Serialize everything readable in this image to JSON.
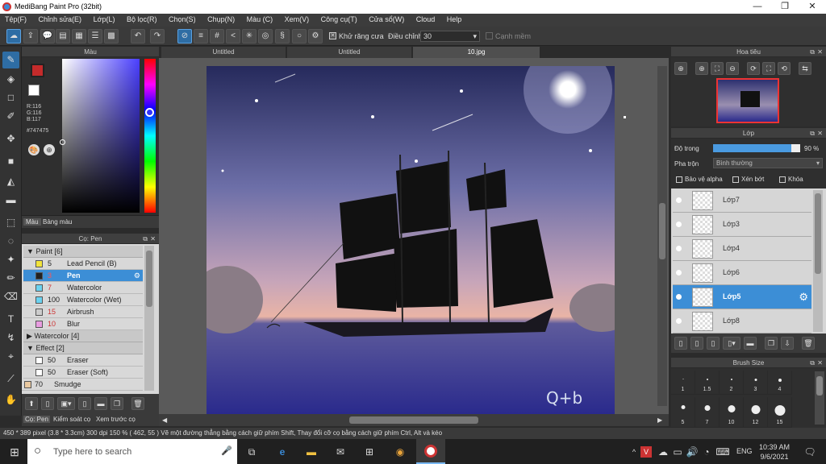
{
  "window": {
    "title": "MediBang Paint Pro (32bit)",
    "minimize": "—",
    "maximize": "❐",
    "close": "✕"
  },
  "menu": [
    "Tệp(F)",
    "Chỉnh sửa(E)",
    "Lớp(L)",
    "Bộ lọc(R)",
    "Chọn(S)",
    "Chụp(N)",
    "Màu (C)",
    "Xem(V)",
    "Công cụ(T)",
    "Cửa sổ(W)",
    "Cloud",
    "Help"
  ],
  "toolbar": {
    "antialias_label": "Khử răng cưa",
    "adjust_label": "Điều chỉnh",
    "adjust_value": "30",
    "edge_label": "Cạnh mềm"
  },
  "tabs": [
    "Untitled",
    "Untitled",
    "10.jpg"
  ],
  "color_panel": {
    "title": "Màu",
    "r": "R:116",
    "g": "G:116",
    "b": "B:117",
    "hex": "#747475",
    "tab_color": "Màu",
    "tab_palette": "Bảng màu",
    "fg": "#c42b2b"
  },
  "brush_panel": {
    "title": "Cọ: Pen",
    "groups": [
      {
        "name": "Paint [6]"
      },
      {
        "name": "Watercolor [4]"
      },
      {
        "name": "Effect [2]"
      }
    ],
    "brushes": [
      {
        "size": "5",
        "name": "Lead Pencil (B)",
        "color": "#f2e43a"
      },
      {
        "size": "3",
        "name": "Pen",
        "color": "#222222"
      },
      {
        "size": "7",
        "name": "Watercolor",
        "color": "#6bd2f0"
      },
      {
        "size": "100",
        "name": "Watercolor (Wet)",
        "color": "#6bd2f0"
      },
      {
        "size": "15",
        "name": "Airbrush",
        "color": "#cccccc"
      },
      {
        "size": "10",
        "name": "Blur",
        "color": "#e89ce0"
      },
      {
        "size": "50",
        "name": "Eraser",
        "color": "#ffffff"
      },
      {
        "size": "50",
        "name": "Eraser (Soft)",
        "color": "#ffffff"
      },
      {
        "size": "70",
        "name": "Smudge",
        "color": "#e8c8a0"
      }
    ],
    "bottom_tabs": [
      "Cọ: Pen",
      "Kiểm soát cọ",
      "Xem trước cọ"
    ]
  },
  "navigator": {
    "title": "Hoa tiêu"
  },
  "layer_panel": {
    "title": "Lớp",
    "opacity_label": "Độ trong",
    "opacity_value": "90 %",
    "opacity": 0.9,
    "blend_label": "Pha trộn",
    "blend_value": "Bình thường",
    "protect_alpha": "Bảo vệ alpha",
    "clipping": "Xén bớt",
    "lock": "Khóa",
    "layers": [
      "Lớp7",
      "Lớp3",
      "Lớp4",
      "Lớp6",
      "Lớp5",
      "Lớp8"
    ],
    "selected": "Lớp5"
  },
  "brush_size": {
    "title": "Brush Size",
    "sizes": [
      "1",
      "1.5",
      "2",
      "3",
      "4",
      "5",
      "7",
      "10",
      "12",
      "15"
    ]
  },
  "canvas": {
    "watermark": "Q+b"
  },
  "status": "450 * 389 pixel  (3.8 * 3.3cm)  300 dpi  150 %  ( 462, 55 )  Vẽ một đường thẳng bằng cách giữ phím Shift, Thay đổi cỡ cọ bằng cách giữ phím Ctrl, Alt và kéo",
  "taskbar": {
    "search_placeholder": "Type here to search",
    "lang": "ENG",
    "time": "10:39 AM",
    "date": "9/6/2021"
  }
}
